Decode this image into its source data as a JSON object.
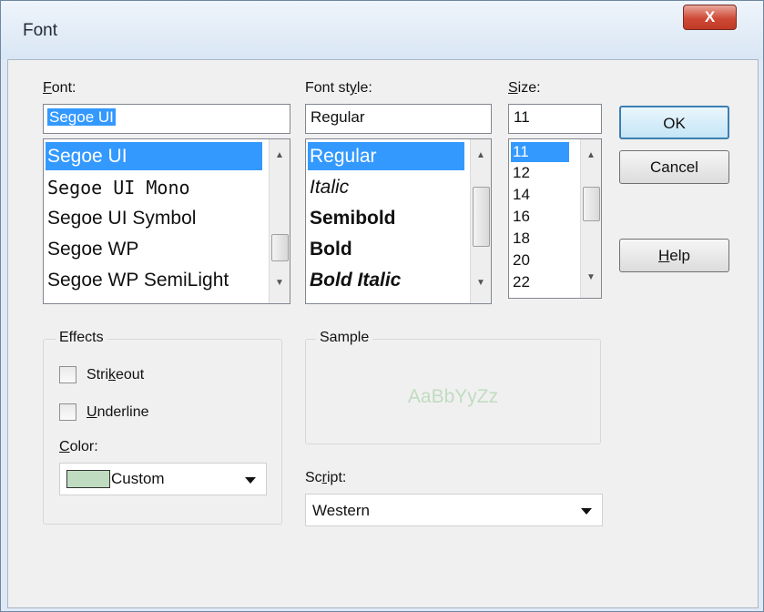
{
  "window": {
    "title": "Font",
    "close_glyph": "X"
  },
  "font": {
    "label": "Font:",
    "value": "Segoe UI",
    "items": [
      "Segoe UI",
      "Segoe UI Mono",
      "Segoe UI Symbol",
      "Segoe WP",
      "Segoe WP SemiLight"
    ],
    "selected": "Segoe UI"
  },
  "style": {
    "label": "Font style:",
    "value": "Regular",
    "items": [
      "Regular",
      "Italic",
      "Semibold",
      "Bold",
      "Bold Italic"
    ],
    "selected": "Regular"
  },
  "size": {
    "label": "Size:",
    "value": "11",
    "items": [
      "11",
      "12",
      "14",
      "16",
      "18",
      "20",
      "22"
    ],
    "selected": "11"
  },
  "buttons": {
    "ok": "OK",
    "cancel": "Cancel",
    "help": "Help"
  },
  "effects": {
    "title": "Effects",
    "strikeout": {
      "label": "Strikeout",
      "checked": false
    },
    "underline": {
      "label": "Underline",
      "checked": false
    },
    "color_label": "Color:",
    "color_value": "Custom",
    "swatch_color": "#c0dcc0"
  },
  "sample": {
    "title": "Sample",
    "text": "AaBbYyZz",
    "text_color": "#c0dcc0"
  },
  "script": {
    "label": "Script:",
    "value": "Western"
  },
  "colors": {
    "selection": "#3399ff",
    "ok_border": "#3c7fb1"
  }
}
